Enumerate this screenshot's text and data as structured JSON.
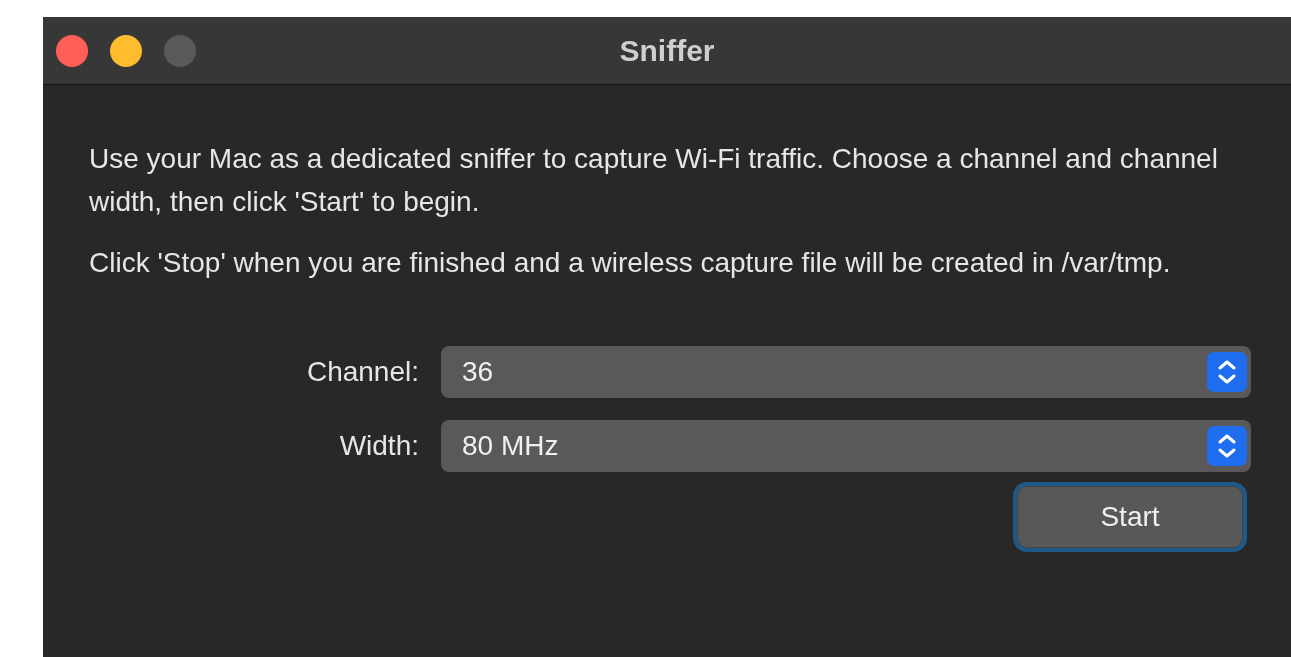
{
  "window": {
    "title": "Sniffer",
    "traffic_lights": [
      {
        "color": "#ff5f57"
      },
      {
        "color": "#febc2e"
      },
      {
        "color": "#5b5a5a"
      }
    ]
  },
  "paragraphs": [
    "Use your Mac as a dedicated sniffer to capture Wi-Fi traffic. Choose a channel and channel width, then click 'Start' to begin.",
    "Click 'Stop' when you are finished and a wireless capture file will be created in /var/tmp."
  ],
  "fields": [
    {
      "label": "Channel:",
      "value": "36"
    },
    {
      "label": "Width:",
      "value": "80 MHz"
    }
  ],
  "start_button": {
    "label": "Start",
    "focused": true
  }
}
